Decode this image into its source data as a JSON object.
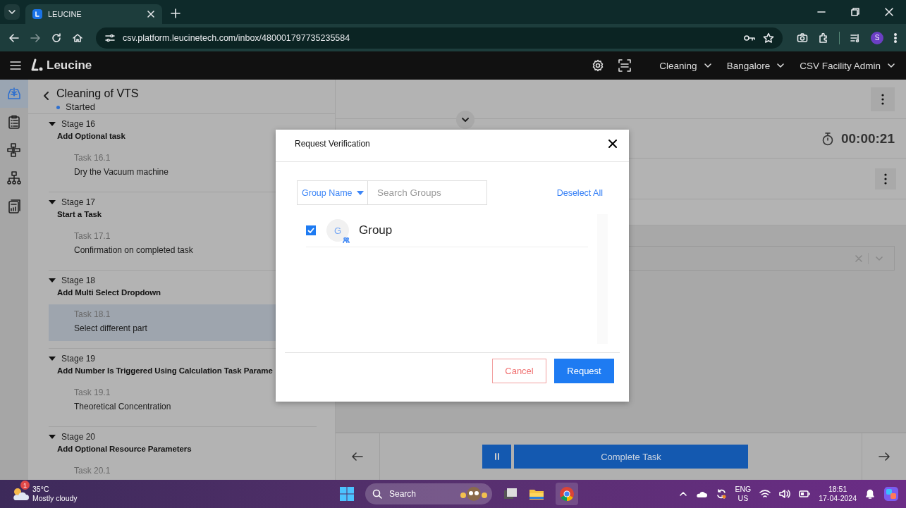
{
  "browser": {
    "tab_title": "LEUCINE",
    "url": "csv.platform.leucinetech.com/inbox/480001797735235584",
    "profile_initial": "S"
  },
  "app_header": {
    "brand": "Leucine",
    "dropdowns": [
      "Cleaning",
      "Bangalore",
      "CSV Facility Admin"
    ]
  },
  "nav_rail": [
    {
      "kind": "inbox",
      "selected": true
    },
    {
      "kind": "checklist",
      "selected": false
    },
    {
      "kind": "flow",
      "selected": false
    },
    {
      "kind": "hierarchy",
      "selected": false
    },
    {
      "kind": "report",
      "selected": false
    }
  ],
  "job": {
    "title": "Cleaning of VTS",
    "status": "Started"
  },
  "stages": [
    {
      "label": "Stage 16",
      "name": "Add Optional task",
      "tasks": [
        {
          "number": "Task 16.1",
          "name": "Dry the Vacuum machine",
          "selected": false
        }
      ]
    },
    {
      "label": "Stage 17",
      "name": "Start a Task",
      "tasks": [
        {
          "number": "Task 17.1",
          "name": "Confirmation on completed task",
          "selected": false
        }
      ]
    },
    {
      "label": "Stage 18",
      "name": "Add Multi Select Dropdown",
      "tasks": [
        {
          "number": "Task 18.1",
          "name": "Select different part",
          "selected": true
        }
      ]
    },
    {
      "label": "Stage 19",
      "name": "Add Number Is Triggered Using Calculation Task Parame",
      "tasks": [
        {
          "number": "Task 19.1",
          "name": "Theoretical Concentration",
          "selected": false
        }
      ]
    },
    {
      "label": "Stage 20",
      "name": "Add Optional Resource Parameters",
      "tasks": [
        {
          "number": "Task 20.1",
          "selected": false
        }
      ]
    }
  ],
  "task_panel": {
    "timer": "00:00:21",
    "complete_button": "Complete Task"
  },
  "modal": {
    "title": "Request Verification",
    "filter": "Group Name",
    "search": {
      "placeholder": "Search Groups"
    },
    "deselect_all": "Deselect All",
    "groups": [
      {
        "initial": "G",
        "name": "Group",
        "checked": true
      }
    ],
    "cancel": "Cancel",
    "request": "Request"
  },
  "taskbar": {
    "weather_badge": "1",
    "temperature": "35°C",
    "condition": "Mostly cloudy",
    "search": "Search",
    "language": "ENG",
    "region": "US",
    "time": "18:51",
    "date": "17-04-2024"
  }
}
